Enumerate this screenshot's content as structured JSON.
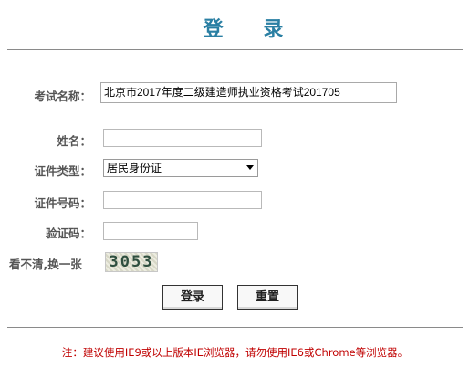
{
  "page": {
    "title": "登  录"
  },
  "form": {
    "exam_name": {
      "label": "考试名称：",
      "value": "北京市2017年度二级建造师执业资格考试201705"
    },
    "name": {
      "label": "姓名：",
      "value": ""
    },
    "id_type": {
      "label": "证件类型：",
      "selected": "居民身份证"
    },
    "id_number": {
      "label": "证件号码：",
      "value": ""
    },
    "captcha_input": {
      "label": "验证码：",
      "value": ""
    },
    "refresh_captcha": {
      "label": "看不清,换一张"
    },
    "captcha_image": {
      "text": "3053"
    }
  },
  "buttons": {
    "login": "登录",
    "reset": "重置"
  },
  "notice": "注：建议使用IE9或以上版本IE浏览器，请勿使用IE6或Chrome等浏览器。"
}
